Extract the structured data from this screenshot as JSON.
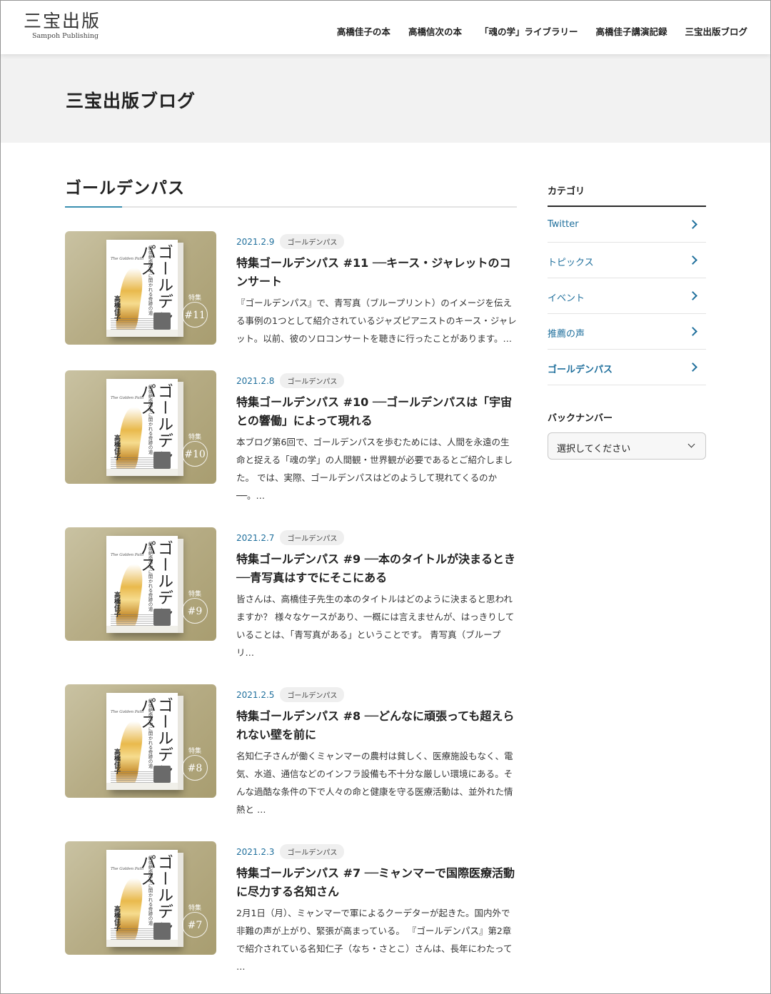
{
  "header": {
    "logo_main": "三宝出版",
    "logo_sub": "Sampoh Publishing",
    "nav": [
      {
        "label": "高橋佳子の本"
      },
      {
        "label": "高橋信次の本"
      },
      {
        "label": "「魂の学」ライブラリー"
      },
      {
        "label": "高橋佳子講演記録"
      },
      {
        "label": "三宝出版ブログ"
      }
    ]
  },
  "banner": {
    "title": "三宝出版ブログ"
  },
  "main": {
    "section_title": "ゴールデンパス",
    "book_cover": {
      "title": "ゴールデンパス",
      "subtitle": "絶体絶命の中に開かれる奇跡の道",
      "en_title": "The Golden Path",
      "author": "高橋佳子",
      "badge_label": "特集"
    },
    "posts": [
      {
        "date": "2021.2.9",
        "category": "ゴールデンパス",
        "badge_number": "#11",
        "title": "特集ゴールデンパス #11 ──キース・ジャレットのコンサート",
        "excerpt": "『ゴールデンパス』で、青写真（ブループリント）のイメージを伝える事例の1つとして紹介されているジャズピアニストのキース・ジャレット。以前、彼のソロコンサートを聴きに行ったことがあります。…"
      },
      {
        "date": "2021.2.8",
        "category": "ゴールデンパス",
        "badge_number": "#10",
        "title": "特集ゴールデンパス #10 ──ゴールデンパスは「宇宙との響働」によって現れる",
        "excerpt": "本ブログ第6回で、ゴールデンパスを歩むためには、人間を永遠の生命と捉える「魂の学」の人間観・世界観が必要であるとご紹介しました。 では、実際、ゴールデンパスはどのようして現れてくるのか──。…"
      },
      {
        "date": "2021.2.7",
        "category": "ゴールデンパス",
        "badge_number": "#9",
        "title": "特集ゴールデンパス #9 ──本のタイトルが決まるとき──青写真はすでにそこにある",
        "excerpt": "皆さんは、高橋佳子先生の本のタイトルはどのように決まると思われますか？ 様々なケースがあり、一概には言えませんが、はっきりしていることは、「青写真がある」ということです。 青写真（ブループリ…"
      },
      {
        "date": "2021.2.5",
        "category": "ゴールデンパス",
        "badge_number": "#8",
        "title": "特集ゴールデンパス #8 ──どんなに頑張っても超えられない壁を前に",
        "excerpt": "名知仁子さんが働くミャンマーの農村は貧しく、医療施設もなく、電気、水道、通信などのインフラ設備も不十分な厳しい環境にある。そんな過酷な条件の下で人々の命と健康を守る医療活動は、並外れた情熱と …"
      },
      {
        "date": "2021.2.3",
        "category": "ゴールデンパス",
        "badge_number": "#7",
        "title": "特集ゴールデンパス #7 ──ミャンマーで国際医療活動に尽力する名知さん",
        "excerpt": "2月1日（月）、ミャンマーで軍によるクーデターが起きた。国内外で非難の声が上がり、緊張が高まっている。 『ゴールデンパス』第2章で紹介されている名知仁子（なち・さとこ）さんは、長年にわたって …"
      }
    ]
  },
  "sidebar": {
    "category_heading": "カテゴリ",
    "categories": [
      {
        "label": "Twitter"
      },
      {
        "label": "トピックス"
      },
      {
        "label": "イベント"
      },
      {
        "label": "推薦の声"
      },
      {
        "label": "ゴールデンパス"
      }
    ],
    "archive_heading": "バックナンバー",
    "archive_select": "選択してください"
  }
}
